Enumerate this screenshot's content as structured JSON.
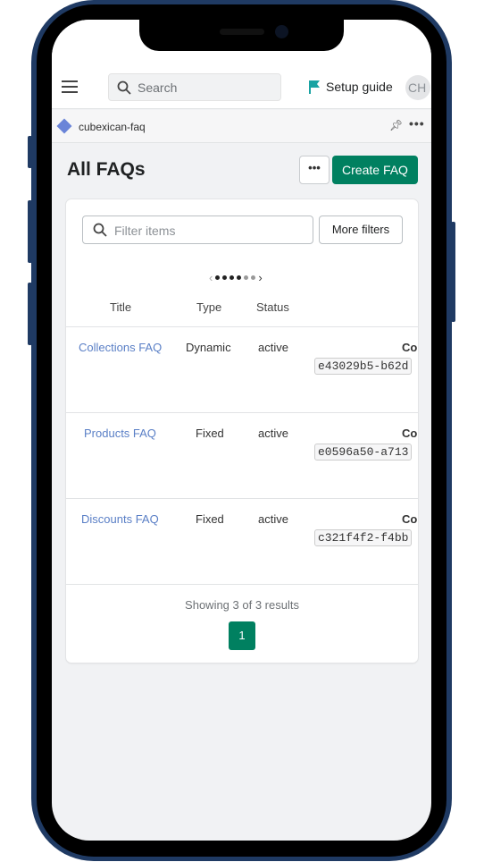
{
  "topbar": {
    "search_placeholder": "Search",
    "setup_guide": "Setup guide",
    "avatar_initials": "CH"
  },
  "app": {
    "name": "cubexican-faq"
  },
  "page": {
    "title": "All FAQs",
    "more_label": "•••",
    "create_label": "Create FAQ"
  },
  "filters": {
    "placeholder": "Filter items",
    "more_filters": "More filters"
  },
  "pagination_dots": {
    "total": 6,
    "active": 4
  },
  "table": {
    "headers": [
      "Title",
      "Type",
      "Status"
    ],
    "truncated_header": "Co",
    "rows": [
      {
        "title": "Collections FAQ",
        "type": "Dynamic",
        "status": "active",
        "code": "e43029b5-b62d"
      },
      {
        "title": "Products FAQ",
        "type": "Fixed",
        "status": "active",
        "code": "e0596a50-a713"
      },
      {
        "title": "Discounts FAQ",
        "type": "Fixed",
        "status": "active",
        "code": "c321f4f2-f4bb"
      }
    ]
  },
  "footer": {
    "showing": "Showing 3 of 3 results",
    "page": "1"
  },
  "colors": {
    "primary": "#008060",
    "link": "#5a7fc6",
    "frame": "#1f3a63",
    "flag": "#1aa3a3"
  }
}
